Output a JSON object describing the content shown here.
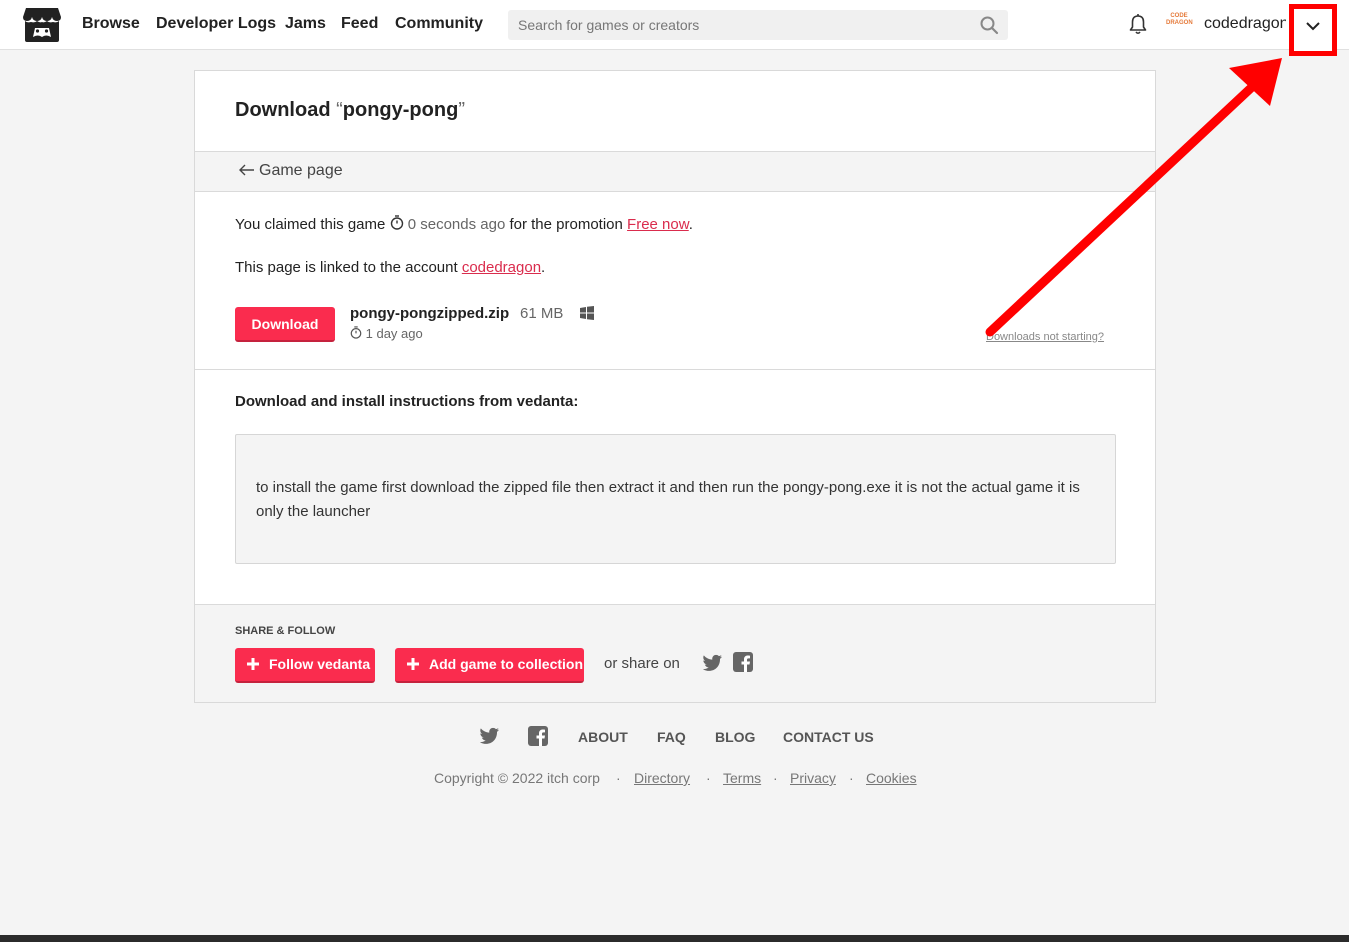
{
  "header": {
    "nav": [
      "Browse",
      "Developer Logs",
      "Jams",
      "Feed",
      "Community"
    ],
    "search_placeholder": "Search for games or creators",
    "avatar_text": "CODE DRAGON",
    "username": "codedragon"
  },
  "card": {
    "title_prefix": "Download ",
    "open_quote": "“",
    "game_name": "pongy-pong",
    "close_quote": "”",
    "back_link": "Game page",
    "claim_text": "You claimed this game",
    "claim_time": "0 seconds ago",
    "claim_mid": "for the promotion",
    "promo_link": "Free now",
    "linked_text": "This page is linked to the account",
    "linked_account": "codedragon",
    "download_label": "Download",
    "file_name": "pongy-pongzipped.zip",
    "file_size": "61 MB",
    "file_date": "1 day ago",
    "downloads_help": "Downloads not starting?",
    "instructions_heading": "Download and install instructions from vedanta:",
    "instructions_text": "to install the game first download the zipped file then extract it and then run the pongy-pong.exe it is not the actual game it is only the launcher"
  },
  "share": {
    "heading": "SHARE & FOLLOW",
    "follow_label": "Follow vedanta",
    "collection_label": "Add game to collection",
    "or_share": "or share on"
  },
  "footer": {
    "links": [
      "ABOUT",
      "FAQ",
      "BLOG",
      "CONTACT US"
    ],
    "copyright": "Copyright © 2022 itch corp",
    "legal": [
      "Directory",
      "Terms",
      "Privacy",
      "Cookies"
    ]
  },
  "colors": {
    "accent": "#fa2c4e",
    "link": "#da2c4d",
    "annotation": "#ff0000"
  }
}
